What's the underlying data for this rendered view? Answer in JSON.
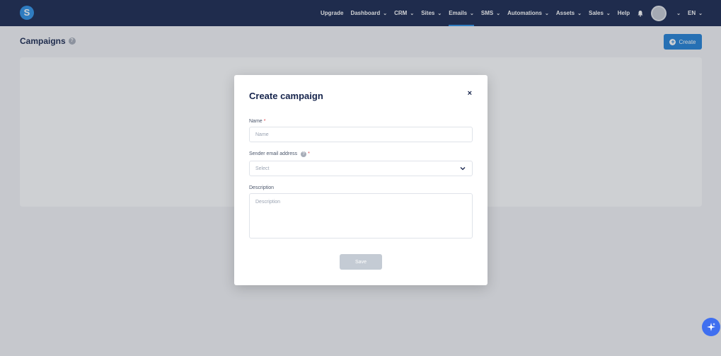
{
  "header": {
    "logo_letter": "S",
    "nav": [
      {
        "label": "Upgrade",
        "has_chevron": false
      },
      {
        "label": "Dashboard",
        "has_chevron": true
      },
      {
        "label": "CRM",
        "has_chevron": true
      },
      {
        "label": "Sites",
        "has_chevron": true
      },
      {
        "label": "Emails",
        "has_chevron": true,
        "active": true
      },
      {
        "label": "SMS",
        "has_chevron": true
      },
      {
        "label": "Automations",
        "has_chevron": true
      },
      {
        "label": "Assets",
        "has_chevron": true
      },
      {
        "label": "Sales",
        "has_chevron": true
      },
      {
        "label": "Help",
        "has_chevron": false
      }
    ],
    "language": "EN",
    "icons": {
      "bell": "bell-icon",
      "avatar": "avatar",
      "chevron": "chevron-down-icon"
    }
  },
  "page": {
    "title": "Campaigns",
    "help_badge": "?",
    "create_button": "Create"
  },
  "modal": {
    "title": "Create campaign",
    "close": "×",
    "name_label": "Name",
    "required_mark": "*",
    "name_placeholder": "Name",
    "sender_label": "Sender email address",
    "sender_help": "?",
    "sender_placeholder": "Select",
    "description_label": "Description",
    "description_placeholder": "Description",
    "save_button": "Save"
  },
  "colors": {
    "topbar": "#16244c",
    "accent": "#1f7fd6",
    "required": "#e0454d",
    "disabled_button": "#c4cbd4",
    "ai_button": "#3f6ff0"
  }
}
